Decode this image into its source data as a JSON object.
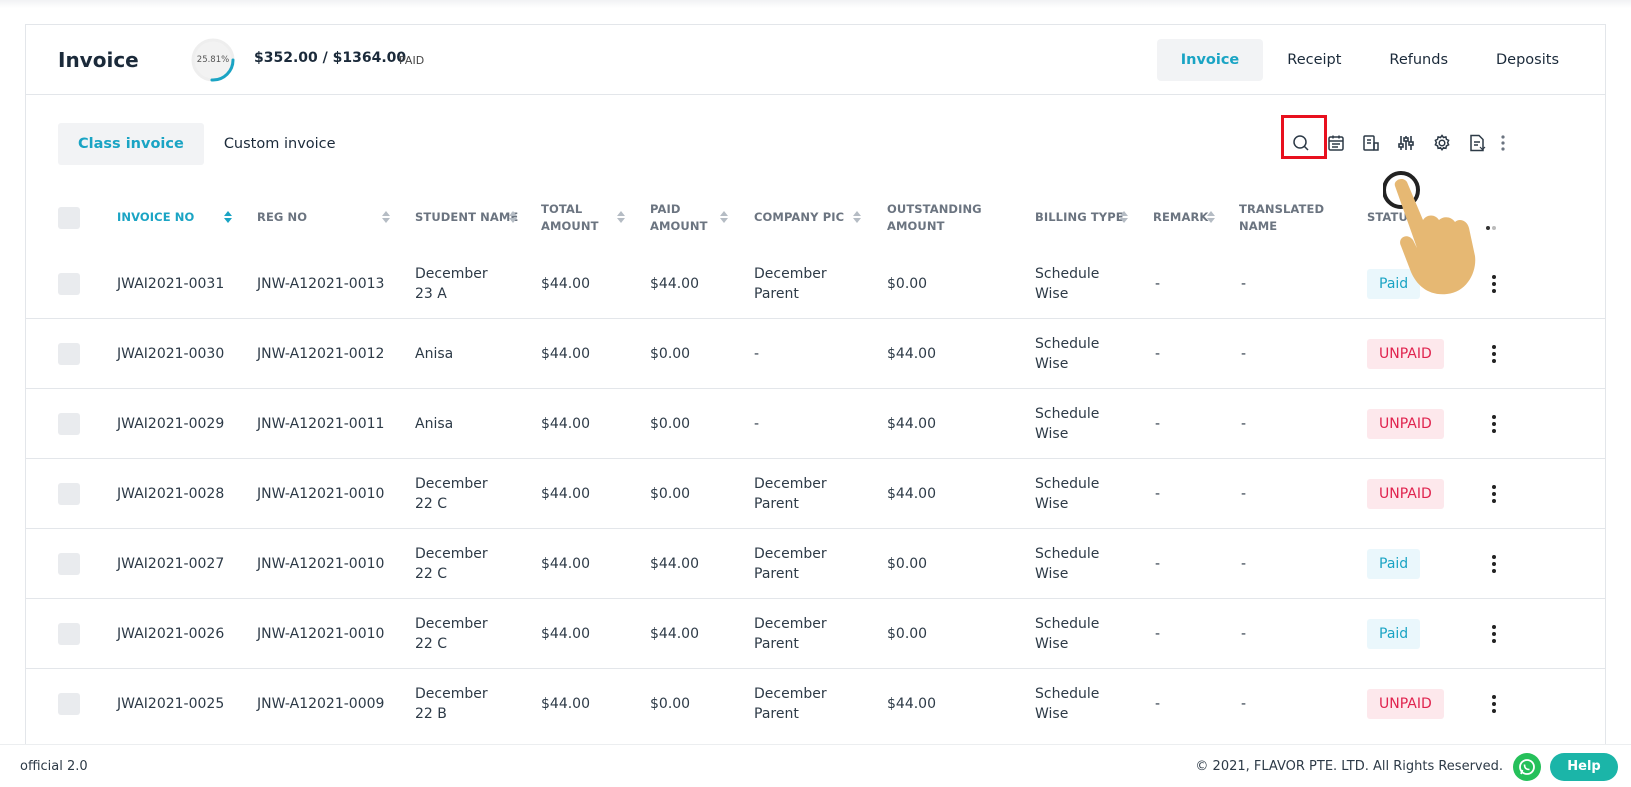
{
  "header": {
    "title": "Invoice",
    "progress_text": "25.81%",
    "progress_percent": 25.81,
    "amount": "$352.00 / $1364.00",
    "paid_label": "PAID"
  },
  "top_tabs": [
    {
      "label": "Invoice",
      "active": true
    },
    {
      "label": "Receipt",
      "active": false
    },
    {
      "label": "Refunds",
      "active": false
    },
    {
      "label": "Deposits",
      "active": false
    }
  ],
  "sub_tabs": [
    {
      "label": "Class invoice",
      "active": true
    },
    {
      "label": "Custom invoice",
      "active": false
    }
  ],
  "toolbar": {
    "icons": [
      "search-icon",
      "calendar-icon",
      "report-icon",
      "filter-sliders-icon",
      "gear-icon",
      "export-document-icon",
      "more-vertical-icon"
    ]
  },
  "table": {
    "columns": [
      {
        "label": "INVOICE NO",
        "active": true
      },
      {
        "label": "REG NO"
      },
      {
        "label": "STUDENT NAME"
      },
      {
        "label": "TOTAL AMOUNT"
      },
      {
        "label": "PAID AMOUNT"
      },
      {
        "label": "COMPANY PIC"
      },
      {
        "label": "OUTSTANDING AMOUNT"
      },
      {
        "label": "BILLING TYPE"
      },
      {
        "label": "REMARK"
      },
      {
        "label": "TRANSLATED NAME"
      },
      {
        "label": "STATUS"
      }
    ],
    "rows": [
      {
        "invoice_no": "JWAI2021-0031",
        "reg_no": "JNW-A12021-0013",
        "student": "December 23 A",
        "total": "$44.00",
        "paid": "$44.00",
        "pic": "December Parent",
        "outstanding": "$0.00",
        "billing": "Schedule Wise",
        "remark": "-",
        "translated": "-",
        "status": "Paid"
      },
      {
        "invoice_no": "JWAI2021-0030",
        "reg_no": "JNW-A12021-0012",
        "student": "Anisa",
        "total": "$44.00",
        "paid": "$0.00",
        "pic": "-",
        "outstanding": "$44.00",
        "billing": "Schedule Wise",
        "remark": "-",
        "translated": "-",
        "status": "UNPAID"
      },
      {
        "invoice_no": "JWAI2021-0029",
        "reg_no": "JNW-A12021-0011",
        "student": "Anisa",
        "total": "$44.00",
        "paid": "$0.00",
        "pic": "-",
        "outstanding": "$44.00",
        "billing": "Schedule Wise",
        "remark": "-",
        "translated": "-",
        "status": "UNPAID"
      },
      {
        "invoice_no": "JWAI2021-0028",
        "reg_no": "JNW-A12021-0010",
        "student": "December 22 C",
        "total": "$44.00",
        "paid": "$0.00",
        "pic": "December Parent",
        "outstanding": "$44.00",
        "billing": "Schedule Wise",
        "remark": "-",
        "translated": "-",
        "status": "UNPAID"
      },
      {
        "invoice_no": "JWAI2021-0027",
        "reg_no": "JNW-A12021-0010",
        "student": "December 22 C",
        "total": "$44.00",
        "paid": "$44.00",
        "pic": "December Parent",
        "outstanding": "$0.00",
        "billing": "Schedule Wise",
        "remark": "-",
        "translated": "-",
        "status": "Paid"
      },
      {
        "invoice_no": "JWAI2021-0026",
        "reg_no": "JNW-A12021-0010",
        "student": "December 22 C",
        "total": "$44.00",
        "paid": "$44.00",
        "pic": "December Parent",
        "outstanding": "$0.00",
        "billing": "Schedule Wise",
        "remark": "-",
        "translated": "-",
        "status": "Paid"
      },
      {
        "invoice_no": "JWAI2021-0025",
        "reg_no": "JNW-A12021-0009",
        "student": "December 22 B",
        "total": "$44.00",
        "paid": "$0.00",
        "pic": "December Parent",
        "outstanding": "$44.00",
        "billing": "Schedule Wise",
        "remark": "-",
        "translated": "-",
        "status": "UNPAID"
      }
    ]
  },
  "footer": {
    "version": "official 2.0",
    "copyright": "© 2021, FLAVOR PTE. LTD. All Rights Reserved.",
    "help_label": "Help"
  },
  "colors": {
    "accent": "#1aa4c4",
    "paid_bg": "#eaf7fc",
    "unpaid_text": "#e0234e",
    "unpaid_bg": "#fde8ec",
    "highlight": "#e8101e",
    "whatsapp": "#25c05a",
    "help": "#1bb5a8"
  }
}
